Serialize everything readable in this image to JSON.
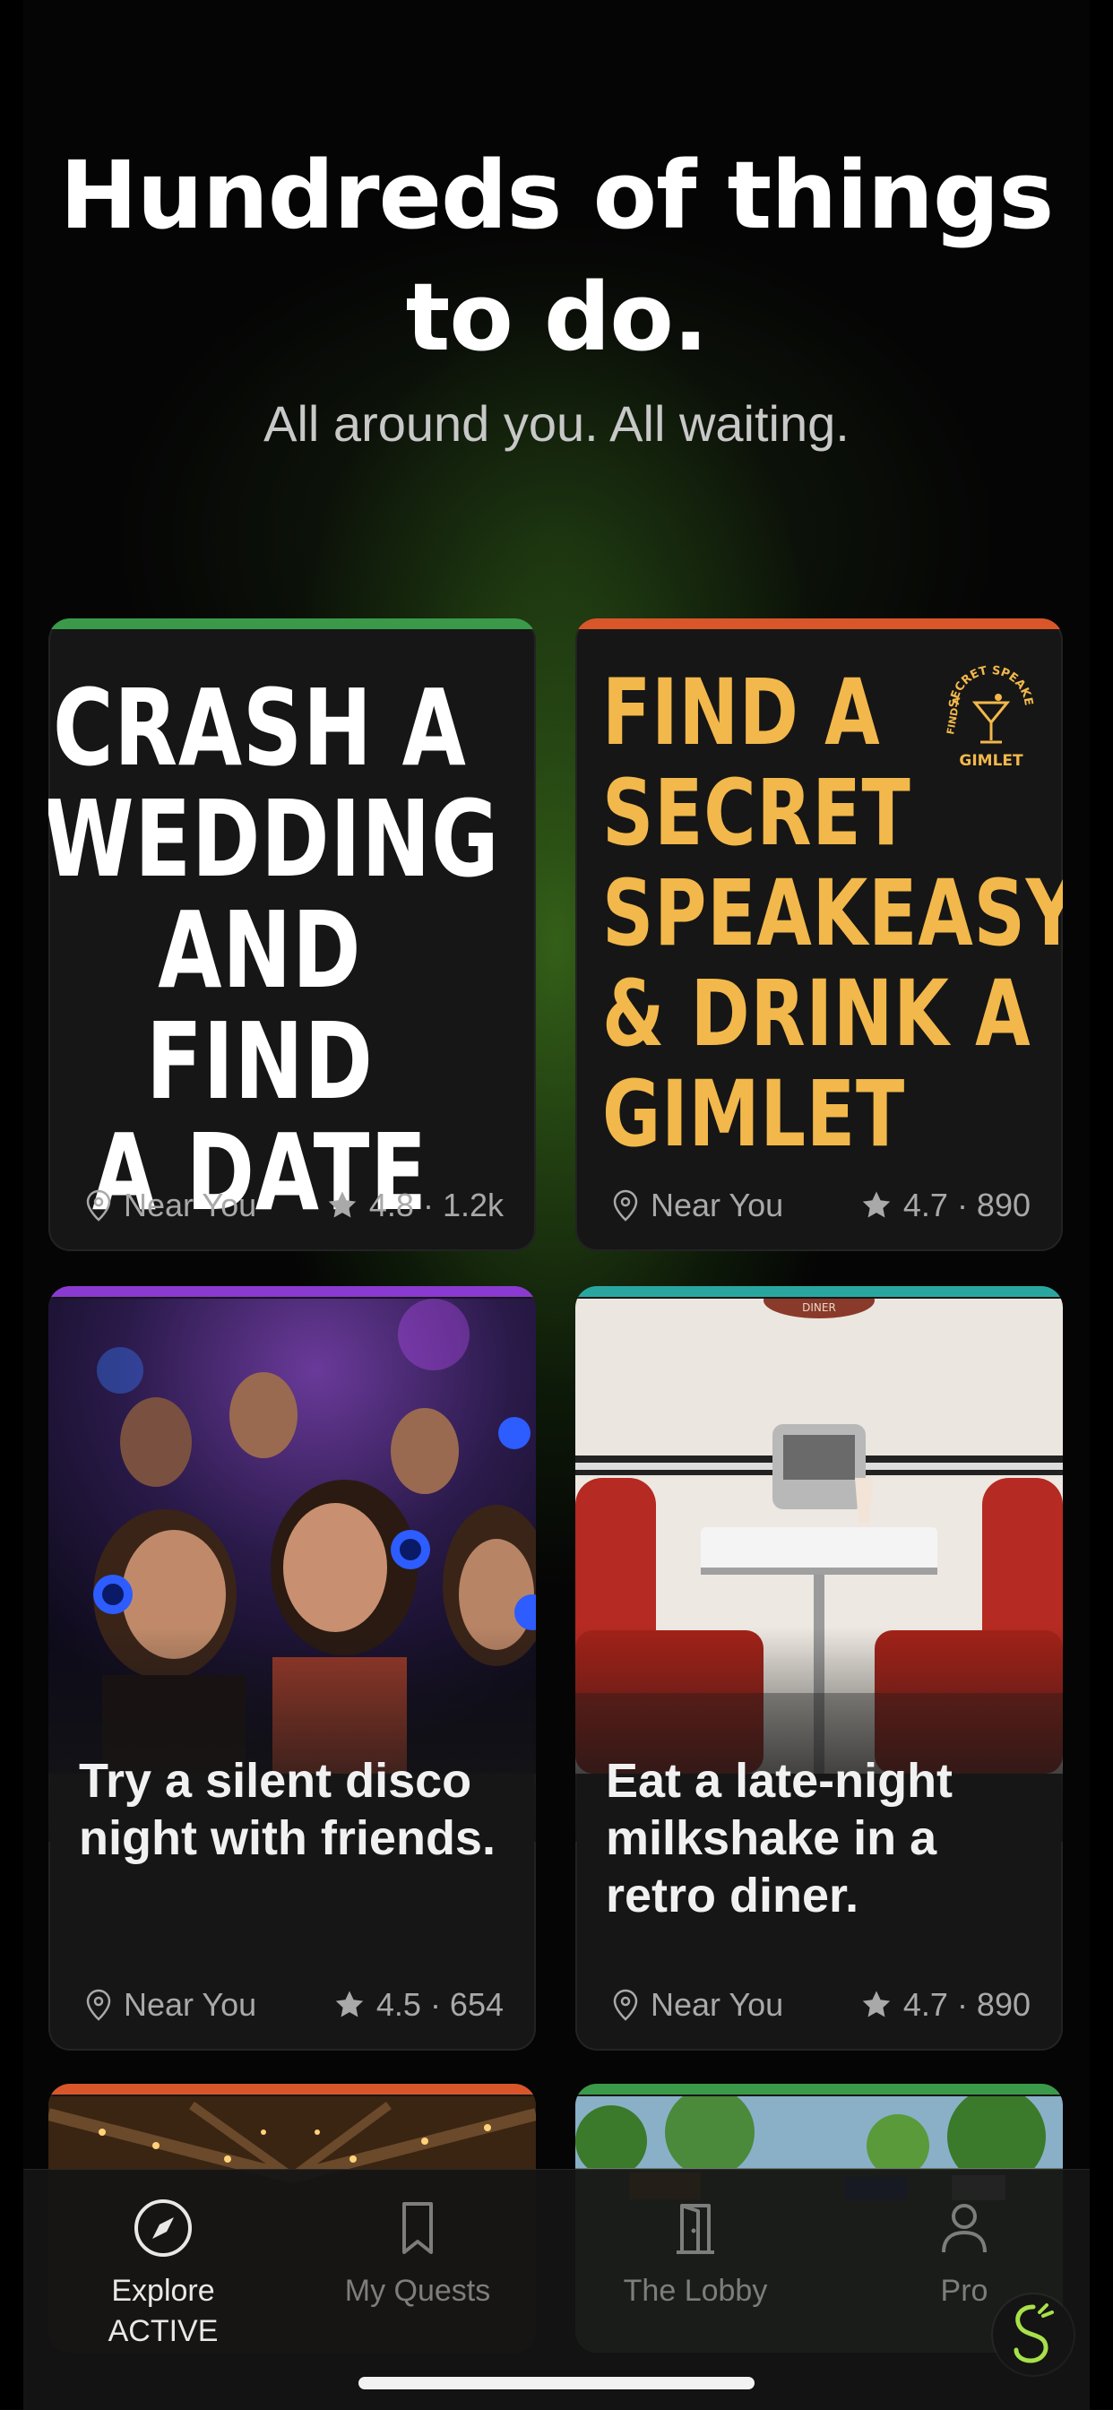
{
  "header": {
    "title_line1": "Hundreds of things",
    "title_line2": "to do.",
    "subtitle": "All around you. All waiting."
  },
  "cards": [
    {
      "poster_lines": [
        "CRASH A",
        "WEDDING",
        "AND FIND",
        "A DATE"
      ],
      "location": "Near You",
      "rating": "4.8 · 1.2k",
      "accent": "#3a9a4a"
    },
    {
      "poster_lines": [
        "FIND A",
        "SECRET",
        "SPEAKEASY",
        "& DRINK A",
        "GIMLET"
      ],
      "badge_text": "SECRET SPEAKEASY",
      "badge_word": "GIMLET",
      "badge_side": "FIND A",
      "location": "Near You",
      "rating": "4.7 · 890",
      "accent": "#d8562a"
    },
    {
      "caption": "Try a silent disco night with friends.",
      "location": "Near You",
      "rating": "4.5 · 654",
      "accent": "#8a3ad0"
    },
    {
      "caption": "Eat a late-night milkshake in a retro diner.",
      "sign_text": "DINER",
      "location": "Near You",
      "rating": "4.7 · 890",
      "accent": "#2aa6a0"
    },
    {
      "accent": "#d8562a"
    },
    {
      "accent": "#3a9a4a"
    }
  ],
  "tabs": [
    {
      "label": "Explore",
      "sublabel": "ACTIVE",
      "icon": "compass-icon"
    },
    {
      "label": "My Quests",
      "icon": "bookmark-icon"
    },
    {
      "label": "The Lobby",
      "icon": "door-icon"
    },
    {
      "label": "Pro",
      "icon": "person-icon"
    }
  ],
  "colors": {
    "poster_gold": "#f2b84b",
    "background": "#050505",
    "glow_green": "#5aaa28"
  }
}
